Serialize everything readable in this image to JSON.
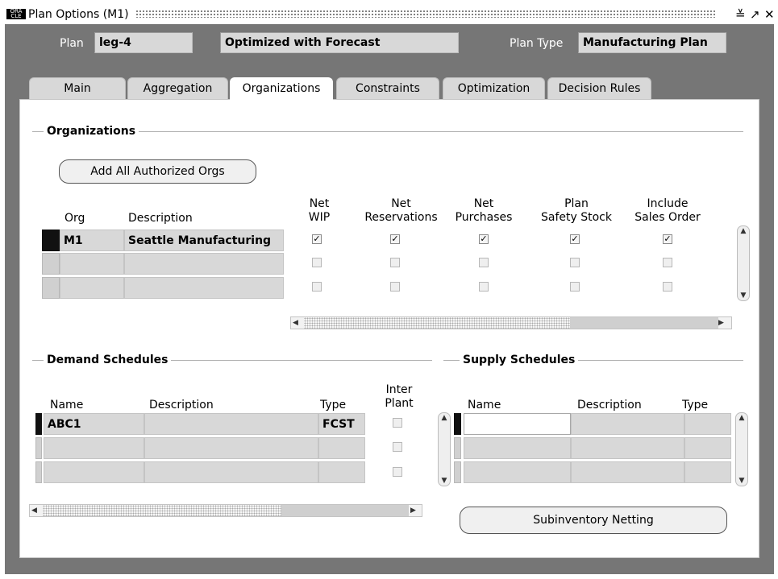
{
  "window": {
    "title": "Plan Options (M1)",
    "logo_text": "ORACLE Applications"
  },
  "header": {
    "plan_label": "Plan",
    "plan_value": "leg-4",
    "description_value": "Optimized with Forecast",
    "plan_type_label": "Plan Type",
    "plan_type_value": "Manufacturing Plan"
  },
  "tabs": [
    {
      "label": "Main"
    },
    {
      "label": "Aggregation"
    },
    {
      "label": "Organizations"
    },
    {
      "label": "Constraints"
    },
    {
      "label": "Optimization"
    },
    {
      "label": "Decision Rules"
    }
  ],
  "active_tab": "Organizations",
  "organizations": {
    "section_title": "Organizations",
    "add_button": "Add All Authorized Orgs",
    "columns": {
      "org": "Org",
      "description": "Description",
      "net_wip": [
        "Net",
        "WIP"
      ],
      "net_reservations": [
        "Net",
        "Reservations"
      ],
      "net_purchases": [
        "Net",
        "Purchases"
      ],
      "plan_safety_stock": [
        "Plan",
        "Safety Stock"
      ],
      "include_sales_order": [
        "Include",
        "Sales Order"
      ]
    },
    "rows": [
      {
        "org": "M1",
        "description": "Seattle Manufacturing",
        "net_wip": true,
        "net_reservations": true,
        "net_purchases": true,
        "plan_safety_stock": true,
        "include_sales_order": true
      },
      {
        "org": "",
        "description": "",
        "net_wip": false,
        "net_reservations": false,
        "net_purchases": false,
        "plan_safety_stock": false,
        "include_sales_order": false
      },
      {
        "org": "",
        "description": "",
        "net_wip": false,
        "net_reservations": false,
        "net_purchases": false,
        "plan_safety_stock": false,
        "include_sales_order": false
      }
    ]
  },
  "demand_schedules": {
    "section_title": "Demand Schedules",
    "columns": {
      "name": "Name",
      "description": "Description",
      "type": "Type",
      "inter_plant": [
        "Inter",
        "Plant"
      ]
    },
    "rows": [
      {
        "name": "ABC1",
        "description": "",
        "type": "FCST",
        "inter_plant": false
      },
      {
        "name": "",
        "description": "",
        "type": "",
        "inter_plant": false
      },
      {
        "name": "",
        "description": "",
        "type": "",
        "inter_plant": false
      }
    ]
  },
  "supply_schedules": {
    "section_title": "Supply Schedules",
    "columns": {
      "name": "Name",
      "description": "Description",
      "type": "Type"
    },
    "rows": [
      {
        "name": "",
        "description": "",
        "type": ""
      },
      {
        "name": "",
        "description": "",
        "type": ""
      },
      {
        "name": "",
        "description": "",
        "type": ""
      }
    ]
  },
  "subinventory_button": "Subinventory Netting",
  "colors": {
    "window_bg": "#767676",
    "field_bg": "#d8d8d8",
    "panel_bg": "#ffffff"
  }
}
